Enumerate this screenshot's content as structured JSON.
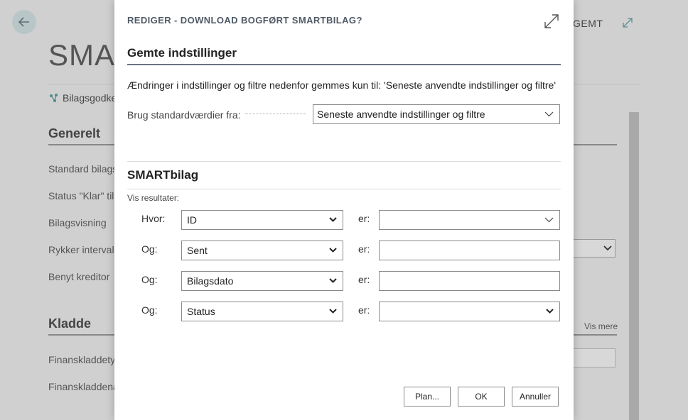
{
  "background": {
    "title": "SMAR",
    "action_label": "Bilagsgodke",
    "saved_label": "GEMT",
    "section_generelt": "Generelt",
    "fields_generelt": [
      "Standard bilags",
      "Status \"Klar\" til",
      "Bilagsvisning",
      "Rykker interval",
      "Benyt kreditor"
    ],
    "section_kladde": "Kladde",
    "fields_kladde": [
      "Finanskladdety",
      "Finanskladdena"
    ],
    "vis_mere": "Vis mere"
  },
  "dialog": {
    "caption": "REDIGER - DOWNLOAD BOGFØRT SMARTBILAG?",
    "saved_settings_heading": "Gemte indstillinger",
    "info_text": "Ændringer i indstillinger og filtre nedenfor gemmes kun til: 'Seneste anvendte indstillinger og filtre'",
    "std_label": "Brug standardværdier fra:",
    "std_value": "Seneste anvendte indstillinger og filtre",
    "smartbilag_heading": "SMARTbilag",
    "vis_resultater": "Vis resultater:",
    "filters": [
      {
        "label": "Hvor:",
        "field": "ID",
        "op": "er:"
      },
      {
        "label": "Og:",
        "field": "Sent",
        "op": "er:"
      },
      {
        "label": "Og:",
        "field": "Bilagsdato",
        "op": "er:"
      },
      {
        "label": "Og:",
        "field": "Status",
        "op": "er:"
      }
    ],
    "buttons": {
      "plan": "Plan...",
      "ok": "OK",
      "cancel": "Annuller"
    }
  }
}
